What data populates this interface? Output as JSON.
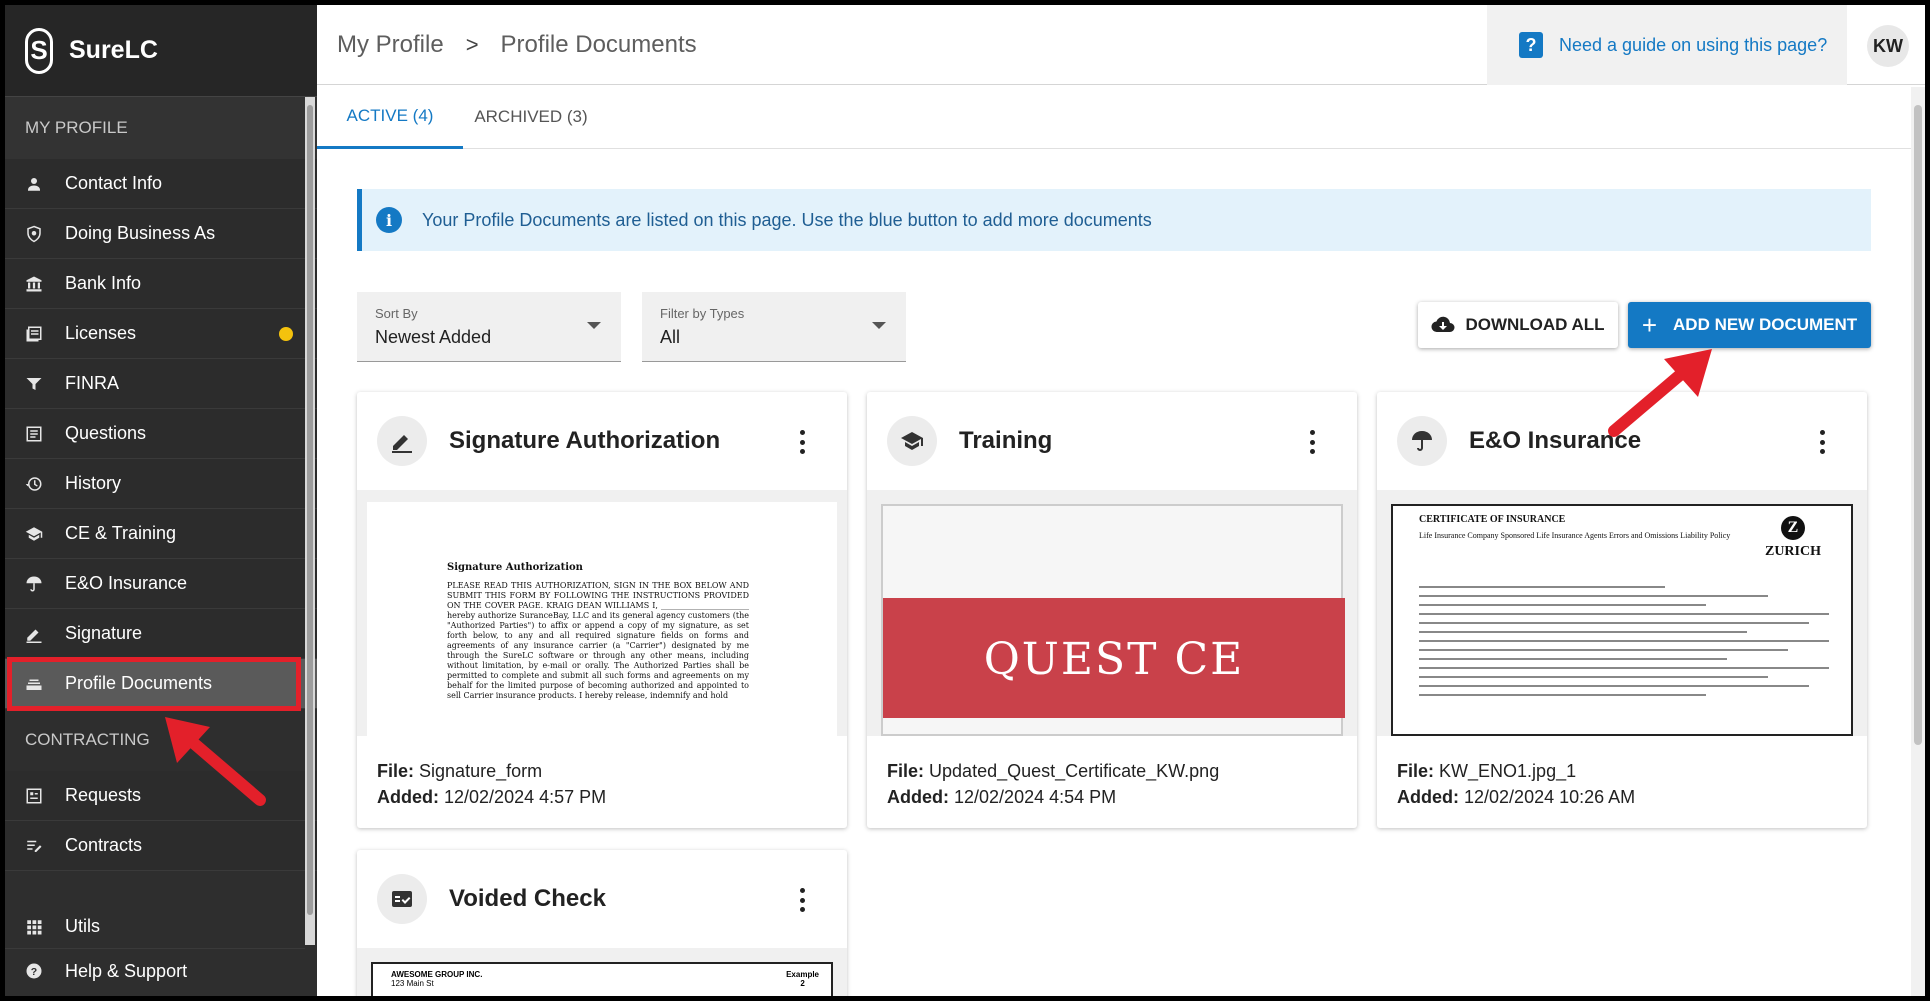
{
  "app": {
    "name": "SureLC"
  },
  "sidebar": {
    "my_profile_header": "MY PROFILE",
    "contracting_header": "CONTRACTING",
    "items": [
      {
        "label": "Contact Info",
        "icon": "person-icon"
      },
      {
        "label": "Doing Business As",
        "icon": "badge-icon"
      },
      {
        "label": "Bank Info",
        "icon": "bank-icon"
      },
      {
        "label": "Licenses",
        "icon": "license-icon",
        "status_dot_color": "#f4c20d"
      },
      {
        "label": "FINRA",
        "icon": "finra-icon"
      },
      {
        "label": "Questions",
        "icon": "questions-icon"
      },
      {
        "label": "History",
        "icon": "history-icon"
      },
      {
        "label": "CE & Training",
        "icon": "graduation-cap-icon"
      },
      {
        "label": "E&O Insurance",
        "icon": "umbrella-icon"
      },
      {
        "label": "Signature",
        "icon": "pen-icon"
      },
      {
        "label": "Profile Documents",
        "icon": "documents-icon",
        "active": true
      }
    ],
    "contracting_items": [
      {
        "label": "Requests",
        "icon": "requests-icon"
      },
      {
        "label": "Contracts",
        "icon": "contracts-icon"
      }
    ],
    "bottom_items": [
      {
        "label": "Utils",
        "icon": "grid-icon"
      },
      {
        "label": "Help & Support",
        "icon": "help-icon"
      }
    ]
  },
  "header": {
    "breadcrumb": [
      "My Profile",
      "Profile Documents"
    ],
    "breadcrumb_separator": ">",
    "guide_text": "Need a guide on using this page?",
    "user_initials": "KW"
  },
  "tabs": [
    {
      "label": "ACTIVE (4)",
      "active": true
    },
    {
      "label": "ARCHIVED (3)",
      "active": false
    }
  ],
  "info_banner": {
    "icon": "info-icon",
    "text": "Your Profile Documents are listed on this page. Use the blue button to add more documents"
  },
  "filters": {
    "sort": {
      "label": "Sort By",
      "value": "Newest Added"
    },
    "type": {
      "label": "Filter by Types",
      "value": "All"
    }
  },
  "actions": {
    "download_all": "DOWNLOAD ALL",
    "add_new": "ADD NEW DOCUMENT",
    "add_new_icon": "+"
  },
  "cards": [
    {
      "title": "Signature Authorization",
      "icon": "pen-icon",
      "file_label": "File:",
      "file": "Signature_form",
      "added_label": "Added:",
      "added": "12/02/2024 4:57 PM",
      "preview": {
        "heading": "Signature Authorization",
        "body": "PLEASE READ THIS AUTHORIZATION, SIGN IN THE BOX BELOW AND SUBMIT THIS FORM BY FOLLOWING THE INSTRUCTIONS PROVIDED ON THE COVER PAGE. KRAIG DEAN WILLIAMS I, ______________________ hereby authorize SuranceBay, LLC and its general agency customers (the \"Authorized Parties\") to affix or append a copy of my signature, as set forth below, to any and all required signature fields on forms and agreements of any insurance carrier (a \"Carrier\") designated by me through the SureLC software or through any other means, including without limitation, by e-mail or orally. The Authorized Parties shall be permitted to complete and submit all such forms and agreements on my behalf for the limited purpose of becoming authorized and appointed to sell Carrier insurance products. I hereby release, indemnify and hold"
      }
    },
    {
      "title": "Training",
      "icon": "graduation-cap-icon",
      "file_label": "File:",
      "file": "Updated_Quest_Certificate_KW.png",
      "added_label": "Added:",
      "added": "12/02/2024 4:54 PM",
      "preview": {
        "heading": "QUEST CE"
      }
    },
    {
      "title": "E&O Insurance",
      "icon": "umbrella-icon",
      "file_label": "File:",
      "file": "KW_ENO1.jpg_1",
      "added_label": "Added:",
      "added": "12/02/2024 10:26 AM",
      "preview": {
        "heading": "CERTIFICATE OF INSURANCE",
        "subheading": "Life Insurance Company Sponsored Life Insurance Agents Errors and Omissions Liability Policy",
        "brand": "ZURICH",
        "brand_mark": "Z"
      }
    },
    {
      "title": "Voided Check",
      "icon": "check-icon",
      "preview": {
        "heading": "AWESOME GROUP INC.",
        "address": "123 Main St",
        "corner": "Example",
        "corner_num": "2"
      }
    }
  ],
  "colors": {
    "accent": "#1479c4",
    "annotation": "#e3202a",
    "sidebar_bg": "#2e2e2e",
    "info_bg": "#e3f2fb"
  }
}
